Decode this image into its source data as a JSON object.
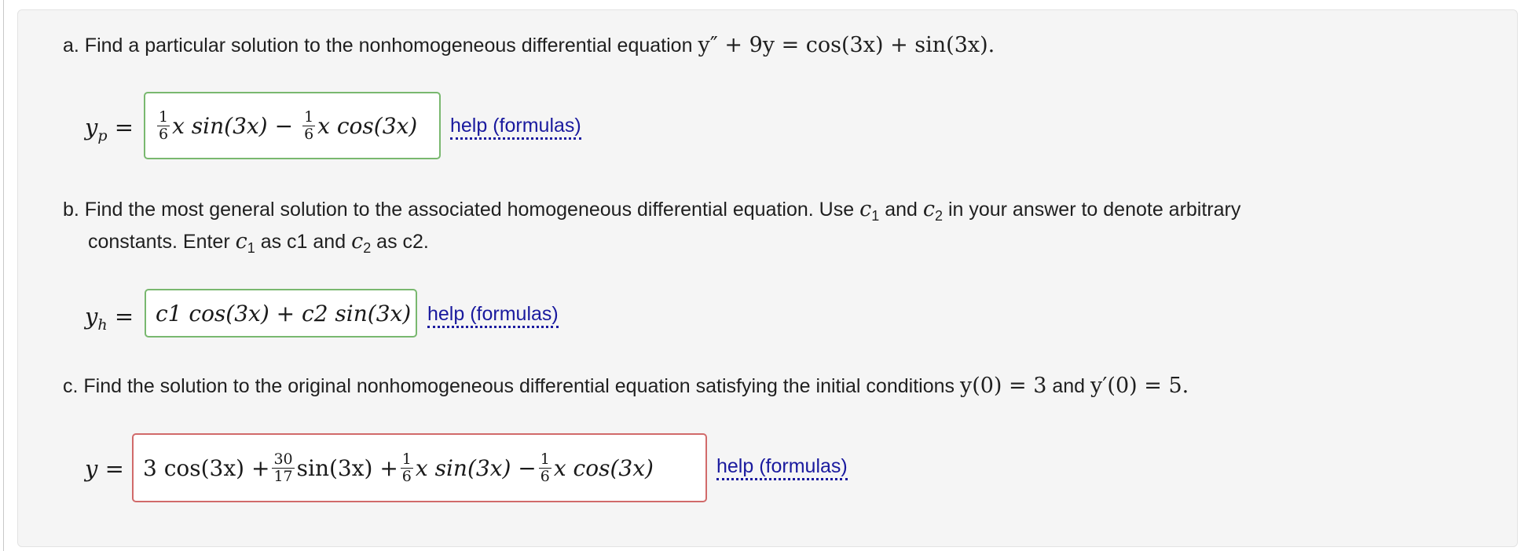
{
  "part_a": {
    "prefix": "a. Find a particular solution to the nonhomogeneous differential equation",
    "equation": "y″ + 9y = cos(3x) + sin(3x).",
    "answer_var": "y",
    "answer_sub": "p",
    "answer": {
      "t1_num": "1",
      "t1_den": "6",
      "t1_rest": "x sin(3x)",
      "op": "−",
      "t2_num": "1",
      "t2_den": "6",
      "t2_rest": "x cos(3x)"
    },
    "status_color": "#79b86f",
    "help_label": "help (formulas)"
  },
  "part_b": {
    "line1_prefix": "b. Find the most general solution to the associated homogeneous differential equation. Use",
    "c1": "c",
    "c1_sub": "1",
    "and": "and",
    "c2": "c",
    "c2_sub": "2",
    "line1_suffix": "in your answer to denote arbitrary",
    "line2_a": "constants. Enter",
    "line2_b": "as c1 and",
    "line2_c": "as c2.",
    "answer_var": "y",
    "answer_sub": "h",
    "answer": "c1 cos(3x) + c2 sin(3x)",
    "status_color": "#79b86f",
    "help_label": "help (formulas)"
  },
  "part_c": {
    "prefix": "c. Find the solution to the original nonhomogeneous differential equation satisfying the initial conditions",
    "cond1": "y(0) = 3",
    "and": "and",
    "cond2": "y′(0) = 5.",
    "answer_var": "y",
    "answer": {
      "t0": "3 cos(3x) +",
      "f1_num": "30",
      "f1_den": "17",
      "f1_rest": "sin(3x) +",
      "f2_num": "1",
      "f2_den": "6",
      "f2_rest": "x sin(3x) −",
      "f3_num": "1",
      "f3_den": "6",
      "f3_rest": "x cos(3x)"
    },
    "status_color": "#d16a6a",
    "help_label": "help (formulas)"
  }
}
